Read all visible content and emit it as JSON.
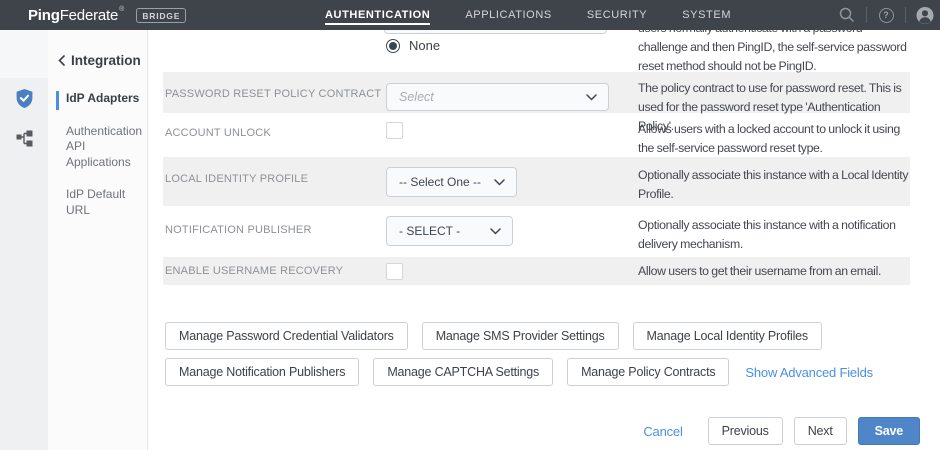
{
  "header": {
    "brand": {
      "ping": "Ping",
      "federate": "Federate",
      "reg": "®",
      "badge": "BRIDGE"
    },
    "nav": [
      {
        "label": "AUTHENTICATION",
        "active": true
      },
      {
        "label": "APPLICATIONS",
        "active": false
      },
      {
        "label": "SECURITY",
        "active": false
      },
      {
        "label": "SYSTEM",
        "active": false
      }
    ],
    "icons": {
      "help_glyph": "?"
    }
  },
  "sidebar": {
    "back_chevron": "‹",
    "section_title": "Integration",
    "items": [
      {
        "label": "IdP Adapters",
        "active": true
      },
      {
        "label": "Authentication API Applications",
        "active": false
      },
      {
        "label": "IdP Default URL",
        "active": false
      }
    ],
    "rail_icons": [
      "shield-check-icon",
      "sitemap-icon"
    ]
  },
  "form": {
    "radio_row": {
      "option": "None",
      "selected": true,
      "description": "users normally authenticate with a password challenge and then PingID, the self-service password reset method should not be PingID."
    },
    "rows": [
      {
        "label": "PASSWORD RESET POLICY CONTRACT",
        "control": "select",
        "value": "Select",
        "placeholder": true,
        "description": "The policy contract to use for password reset. This is used for the password reset type 'Authentication Policy'."
      },
      {
        "label": "ACCOUNT UNLOCK",
        "control": "checkbox",
        "checked": false,
        "description": "Allows users with a locked account to unlock it using the self-service password reset type."
      },
      {
        "label": "LOCAL IDENTITY PROFILE",
        "control": "select",
        "value": "-- Select One --",
        "placeholder": false,
        "description": "Optionally associate this instance with a Local Identity Profile."
      },
      {
        "label": "NOTIFICATION PUBLISHER",
        "control": "select",
        "value": "- SELECT -",
        "placeholder": false,
        "description": "Optionally associate this instance with a notification delivery mechanism."
      },
      {
        "label": "ENABLE USERNAME RECOVERY",
        "control": "checkbox",
        "checked": false,
        "description": "Allow users to get their username from an email."
      }
    ],
    "manage_buttons_row1": [
      "Manage Password Credential Validators",
      "Manage SMS Provider Settings",
      "Manage Local Identity Profiles"
    ],
    "manage_buttons_row2": [
      "Manage Notification Publishers",
      "Manage CAPTCHA Settings",
      "Manage Policy Contracts"
    ],
    "advanced_link": "Show Advanced Fields"
  },
  "actions": {
    "cancel": "Cancel",
    "previous": "Previous",
    "next": "Next",
    "save": "Save"
  },
  "colors": {
    "header_bg": "#3f434a",
    "accent_blue": "#4a90e2",
    "save_blue": "#4e86c8",
    "row_gray": "#f0f0f1",
    "rail_bg": "#eef0f2",
    "shield_blue": "#4a7fc1"
  }
}
